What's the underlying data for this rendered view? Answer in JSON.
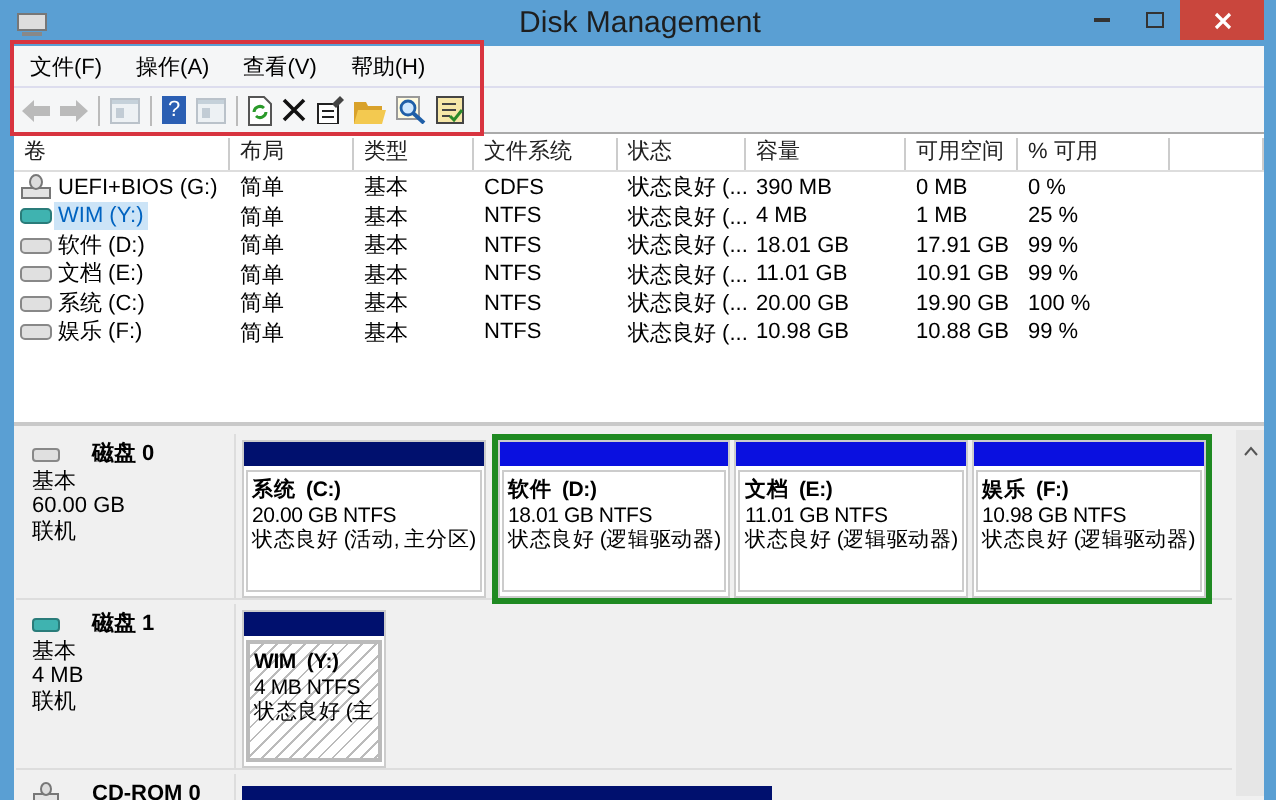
{
  "window": {
    "title": "Disk Management"
  },
  "menu": [
    {
      "label": "文件(F)"
    },
    {
      "label": "操作(A)"
    },
    {
      "label": "查看(V)"
    },
    {
      "label": "帮助(H)"
    }
  ],
  "toolbar": [
    {
      "kind": "back",
      "disabled": true
    },
    {
      "kind": "forward",
      "disabled": true
    },
    {
      "kind": "sep"
    },
    {
      "kind": "panel",
      "disabled": true
    },
    {
      "kind": "sep"
    },
    {
      "kind": "help",
      "disabled": false,
      "glyph": "?"
    },
    {
      "kind": "panel",
      "disabled": true
    },
    {
      "kind": "sep"
    },
    {
      "kind": "refresh",
      "disabled": false
    },
    {
      "kind": "delete",
      "disabled": false
    },
    {
      "kind": "properties",
      "disabled": false
    },
    {
      "kind": "folder",
      "disabled": false
    },
    {
      "kind": "magnifier",
      "disabled": false
    },
    {
      "kind": "checklist",
      "disabled": false
    }
  ],
  "table": {
    "columns": [
      "卷",
      "布局",
      "类型",
      "文件系统",
      "状态",
      "容量",
      "可用空间",
      "% 可用"
    ],
    "rows": [
      {
        "kind": "cd",
        "selected": false,
        "cells": [
          "UEFI+BIOS (G:)",
          "简单",
          "基本",
          "CDFS",
          "状态良好 (...",
          "390 MB",
          "0 MB",
          "0 %"
        ]
      },
      {
        "kind": "removable",
        "selected": true,
        "cells": [
          "WIM (Y:)",
          "简单",
          "基本",
          "NTFS",
          "状态良好 (...",
          "4 MB",
          "1 MB",
          "25 %"
        ]
      },
      {
        "kind": "disk",
        "selected": false,
        "cells": [
          "软件 (D:)",
          "简单",
          "基本",
          "NTFS",
          "状态良好 (...",
          "18.01 GB",
          "17.91 GB",
          "99 %"
        ]
      },
      {
        "kind": "disk",
        "selected": false,
        "cells": [
          "文档 (E:)",
          "简单",
          "基本",
          "NTFS",
          "状态良好 (...",
          "11.01 GB",
          "10.91 GB",
          "99 %"
        ]
      },
      {
        "kind": "disk",
        "selected": false,
        "cells": [
          "系统 (C:)",
          "简单",
          "基本",
          "NTFS",
          "状态良好 (...",
          "20.00 GB",
          "19.90 GB",
          "100 %"
        ]
      },
      {
        "kind": "disk",
        "selected": false,
        "cells": [
          "娱乐 (F:)",
          "简单",
          "基本",
          "NTFS",
          "状态良好 (...",
          "10.98 GB",
          "10.88 GB",
          "99 %"
        ]
      }
    ]
  },
  "disks": [
    {
      "kind": "disk",
      "name": "磁盘 0",
      "type": "基本",
      "size": "60.00 GB",
      "status": "联机",
      "partitions": [
        {
          "kind": "primary",
          "selected": false,
          "name": "系统",
          "letter": "(C:)",
          "size": "20.00 GB NTFS",
          "status": "状态良好 (活动, 主分区)"
        },
        {
          "kind": "logical",
          "selected": false,
          "name": "软件",
          "letter": "(D:)",
          "size": "18.01 GB NTFS",
          "status": "状态良好 (逻辑驱动器)"
        },
        {
          "kind": "logical",
          "selected": false,
          "name": "文档",
          "letter": "(E:)",
          "size": "11.01 GB NTFS",
          "status": "状态良好 (逻辑驱动器)"
        },
        {
          "kind": "logical",
          "selected": false,
          "name": "娱乐",
          "letter": "(F:)",
          "size": "10.98 GB NTFS",
          "status": "状态良好 (逻辑驱动器)"
        }
      ]
    },
    {
      "kind": "removable",
      "name": "磁盘 1",
      "type": "基本",
      "size": "4 MB",
      "status": "联机",
      "partitions": [
        {
          "kind": "primary",
          "selected": true,
          "name": "WIM",
          "letter": "(Y:)",
          "size": "4 MB NTFS",
          "status": "状态良好 (主"
        }
      ]
    },
    {
      "kind": "cdrom",
      "name": "CD-ROM 0"
    }
  ]
}
